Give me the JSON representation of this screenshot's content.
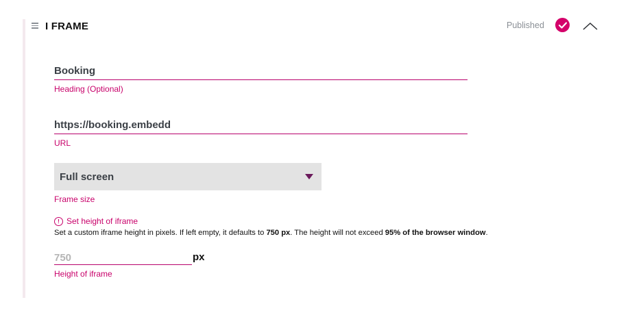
{
  "block": {
    "title": "I FRAME",
    "status": "Published",
    "icons": {
      "drag": "drag-handle-icon",
      "status": "check-circle-icon",
      "collapse": "chevron-up-icon"
    },
    "accent_color": "#d4006a"
  },
  "fields": {
    "heading": {
      "value": "Booking",
      "label": "Heading (Optional)"
    },
    "url": {
      "value": "https://booking.embedd",
      "label": "URL"
    },
    "frame_size": {
      "selected": "Full screen",
      "label": "Frame size"
    }
  },
  "hint": {
    "title": "Set height of iframe",
    "text_1": "Set a custom iframe height in pixels. If left empty, it defaults to ",
    "text_bold_1": "750 px",
    "text_2": ". The height will not exceed ",
    "text_bold_2": "95% of the browser window",
    "text_3": "."
  },
  "height": {
    "placeholder": "750",
    "unit": "px",
    "label": "Height of iframe"
  }
}
